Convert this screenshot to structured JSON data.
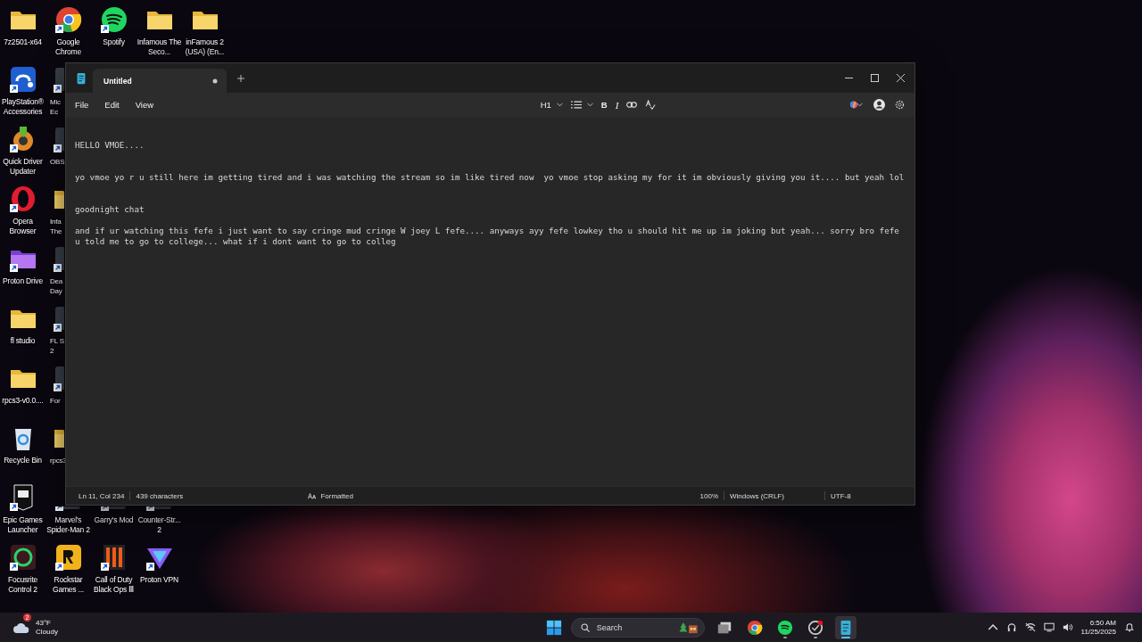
{
  "desktop": {
    "icons": [
      {
        "label": "7z2501-x64",
        "kind": "folder",
        "shortcut": false
      },
      {
        "label": "PlayStation® Accessories",
        "kind": "playstation",
        "shortcut": true
      },
      {
        "label": "Quick Driver Updater",
        "kind": "gear",
        "shortcut": true
      },
      {
        "label": "Opera Browser",
        "kind": "opera",
        "shortcut": true
      },
      {
        "label": "Proton Drive",
        "kind": "purple-folder",
        "shortcut": true
      },
      {
        "label": "fl studio",
        "kind": "folder",
        "shortcut": false
      },
      {
        "label": "rpcs3-v0.0....",
        "kind": "folder",
        "shortcut": false
      },
      {
        "label": "Recycle Bin",
        "kind": "recycle",
        "shortcut": false
      },
      {
        "label": "Epic Games Launcher",
        "kind": "epic",
        "shortcut": true
      },
      {
        "label": "Focusrite Control 2",
        "kind": "focusrite",
        "shortcut": true
      },
      {
        "label": "Google Chrome",
        "kind": "chrome",
        "shortcut": true
      },
      {
        "label": "Mic\nEc",
        "kind": "app",
        "shortcut": true
      },
      {
        "label": "OBS",
        "kind": "app",
        "shortcut": true
      },
      {
        "label": "Infa\nThe",
        "kind": "folder",
        "shortcut": false
      },
      {
        "label": "Dea\nDay",
        "kind": "app",
        "shortcut": true
      },
      {
        "label": "FL S\n2",
        "kind": "app",
        "shortcut": true
      },
      {
        "label": "For",
        "kind": "app",
        "shortcut": true
      },
      {
        "label": "rpcs3",
        "kind": "folder",
        "shortcut": false
      },
      {
        "label": "Marvel's Spider-Man 2",
        "kind": "app",
        "shortcut": true
      },
      {
        "label": "Rockstar Games ...",
        "kind": "rockstar",
        "shortcut": true
      },
      {
        "label": "Spotify",
        "kind": "spotify",
        "shortcut": true
      },
      {
        "label": "Garry's Mod",
        "kind": "app",
        "shortcut": true
      },
      {
        "label": "Call of Duty Black Ops Ⅲ",
        "kind": "cod",
        "shortcut": true
      },
      {
        "label": "Infamous The Seco...",
        "kind": "folder",
        "shortcut": false
      },
      {
        "label": "Counter-Str... 2",
        "kind": "app",
        "shortcut": true
      },
      {
        "label": "Proton VPN",
        "kind": "protonvpn",
        "shortcut": true
      },
      {
        "label": "inFamous 2 (USA) (En...",
        "kind": "folder",
        "shortcut": false
      }
    ]
  },
  "notepad": {
    "tab": {
      "title": "Untitled",
      "modified": true,
      "selected": true
    },
    "menu": [
      "File",
      "Edit",
      "View"
    ],
    "toolbar": {
      "heading": "H1",
      "bold": "B",
      "italic": "I"
    },
    "paragraphs": [
      "HELLO VMOE....",
      "yo vmoe yo r u still here im getting tired and i was watching the stream so im like tired now  yo vmoe stop asking my for it im obviously giving you it.... but yeah lol",
      "goodnight chat",
      "and if ur watching this fefe i just want to say cringe mud cringe W joey L fefe.... anyways ayy fefe lowkey tho u should hit me up im joking but yeah... sorry bro fefe u told me to go to college... what if i dont want to go to colleg"
    ],
    "status": {
      "position": "Ln 11, Col 234",
      "characters": "439 characters",
      "format": "Formatted",
      "zoom": "100%",
      "line_ending": "Windows (CRLF)",
      "encoding": "UTF-8"
    }
  },
  "taskbar": {
    "weather": {
      "badge": "2",
      "temperature": "43°F",
      "condition": "Cloudy"
    },
    "search": {
      "placeholder": "Search"
    },
    "apps": [
      {
        "kind": "task-view",
        "running": false,
        "active": false
      },
      {
        "kind": "chrome",
        "running": false,
        "active": false
      },
      {
        "kind": "spotify",
        "running": true,
        "active": false
      },
      {
        "kind": "badge-app",
        "running": true,
        "active": false
      },
      {
        "kind": "notepad",
        "running": true,
        "active": true
      }
    ],
    "clock": {
      "time": "6:50 AM",
      "date": "11/25/2025"
    }
  }
}
